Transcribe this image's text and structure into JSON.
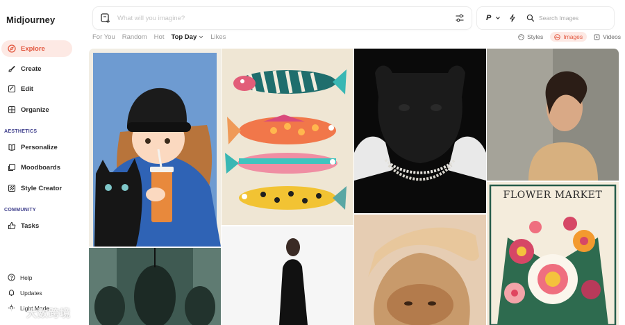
{
  "app": {
    "name": "Midjourney"
  },
  "sidebar": {
    "items": [
      {
        "label": "Explore"
      },
      {
        "label": "Create"
      },
      {
        "label": "Edit"
      },
      {
        "label": "Organize"
      }
    ],
    "aesthetics_label": "AESTHETICS",
    "aesthetics_items": [
      {
        "label": "Personalize"
      },
      {
        "label": "Moodboards"
      },
      {
        "label": "Style Creator"
      }
    ],
    "community_label": "COMMUNITY",
    "community_items": [
      {
        "label": "Tasks"
      }
    ],
    "bottom_items": [
      {
        "label": "Help"
      },
      {
        "label": "Updates"
      },
      {
        "label": "Light Mode"
      }
    ]
  },
  "prompt": {
    "placeholder": "What will you imagine?"
  },
  "search": {
    "placeholder": "Search Images",
    "mode_letter": "P"
  },
  "tabs": [
    {
      "label": "For You"
    },
    {
      "label": "Random"
    },
    {
      "label": "Hot"
    },
    {
      "label": "Top Day"
    },
    {
      "label": "Likes"
    }
  ],
  "filters": [
    {
      "label": "Styles"
    },
    {
      "label": "Images"
    },
    {
      "label": "Videos"
    }
  ],
  "gallery": {
    "poster_title": "FLOWER MARKET"
  },
  "watermark": {
    "text": "大数跨境"
  },
  "colors": {
    "accent": "#e2573f",
    "accent_bg": "#fde9e4"
  }
}
